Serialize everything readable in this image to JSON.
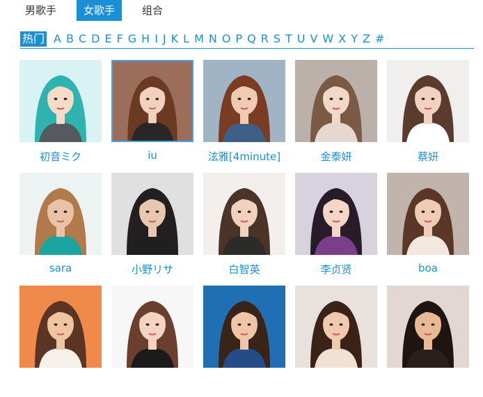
{
  "tabs": [
    {
      "label": "男歌手",
      "active": false
    },
    {
      "label": "女歌手",
      "active": true
    },
    {
      "label": "组合",
      "active": false
    }
  ],
  "letters": [
    "热门",
    "A",
    "B",
    "C",
    "D",
    "E",
    "F",
    "G",
    "H",
    "I",
    "J",
    "K",
    "L",
    "M",
    "N",
    "O",
    "P",
    "Q",
    "R",
    "S",
    "T",
    "U",
    "V",
    "W",
    "X",
    "Y",
    "Z",
    "#"
  ],
  "active_letter": "热门",
  "artists": [
    {
      "name": "初音ミク",
      "bg": "#d9f2f4",
      "hair": "#2fb3b0",
      "skin": "#f6dcc8",
      "cloth": "#555a60",
      "selected": false
    },
    {
      "name": "iu",
      "bg": "#9c6d5a",
      "hair": "#6b3a22",
      "skin": "#f1d2bf",
      "cloth": "#2a2628",
      "selected": true
    },
    {
      "name": "泫雅[4minute]",
      "bg": "#a1b4c6",
      "hair": "#7a3c22",
      "skin": "#f0cbb4",
      "cloth": "#3e5f86",
      "selected": false
    },
    {
      "name": "金泰妍",
      "bg": "#bcb0aa",
      "hair": "#7b5a45",
      "skin": "#f2d8c6",
      "cloth": "#e6d7cf",
      "selected": false
    },
    {
      "name": "蔡妍",
      "bg": "#f1eeee",
      "hair": "#5a3b2d",
      "skin": "#f1d2c0",
      "cloth": "#ffffff",
      "selected": false
    },
    {
      "name": "sara",
      "bg": "#edf3f3",
      "hair": "#b07a4a",
      "skin": "#e9c3a6",
      "cloth": "#1aa5a0",
      "selected": false
    },
    {
      "name": "小野リサ",
      "bg": "#e0e0e0",
      "hair": "#231f20",
      "skin": "#e7c7b0",
      "cloth": "#1f1f1f",
      "selected": false
    },
    {
      "name": "白智英",
      "bg": "#f3efec",
      "hair": "#4a3428",
      "skin": "#f0d2bf",
      "cloth": "#2d2a2a",
      "selected": false
    },
    {
      "name": "李贞贤",
      "bg": "#d8d2df",
      "hair": "#281c28",
      "skin": "#f4d6c6",
      "cloth": "#7a3e8a",
      "selected": false
    },
    {
      "name": "boa",
      "bg": "#c0b4ac",
      "hair": "#5a3726",
      "skin": "#efccb6",
      "cloth": "#f2e8e0",
      "selected": false
    },
    {
      "name": "",
      "bg": "#f08a4a",
      "hair": "#5b3424",
      "skin": "#f0c5a2",
      "cloth": "#f5f0ea",
      "selected": false
    },
    {
      "name": "",
      "bg": "#f7f7f7",
      "hair": "#6a3f2e",
      "skin": "#f3d4c2",
      "cloth": "#1b1b1b",
      "selected": false
    },
    {
      "name": "",
      "bg": "#1f6fb2",
      "hair": "#3a2418",
      "skin": "#eec5a6",
      "cloth": "#244d87",
      "selected": false
    },
    {
      "name": "",
      "bg": "#e8e1de",
      "hair": "#3b2217",
      "skin": "#f0caae",
      "cloth": "#f1e1d5",
      "selected": false
    },
    {
      "name": "",
      "bg": "#e2d7d3",
      "hair": "#1e1412",
      "skin": "#e7b994",
      "cloth": "#2a1f1b",
      "selected": false
    }
  ]
}
